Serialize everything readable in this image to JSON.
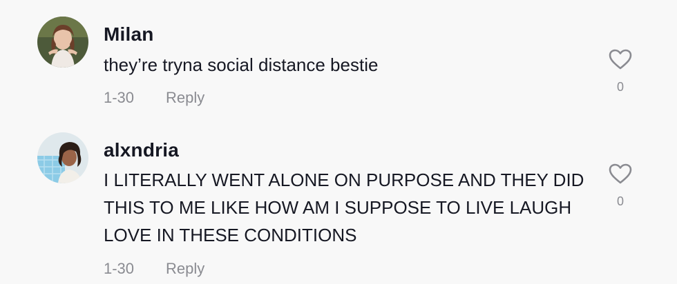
{
  "comments": [
    {
      "username": "Milan",
      "text": "they’re tryna social distance bestie",
      "date": "1-30",
      "reply_label": "Reply",
      "like_count": "0",
      "like_icon": "heart-outline-icon"
    },
    {
      "username": "alxndria",
      "text": "I LITERALLY WENT ALONE ON PURPOSE AND THEY DID THIS TO ME LIKE HOW AM I SUPPOSE TO LIVE LAUGH LOVE IN THESE CONDITIONS",
      "date": "1-30",
      "reply_label": "Reply",
      "like_count": "0",
      "like_icon": "heart-outline-icon"
    }
  ],
  "colors": {
    "background": "#f8f8f8",
    "primary_text": "#161823",
    "secondary_text": "#8a8b91"
  }
}
